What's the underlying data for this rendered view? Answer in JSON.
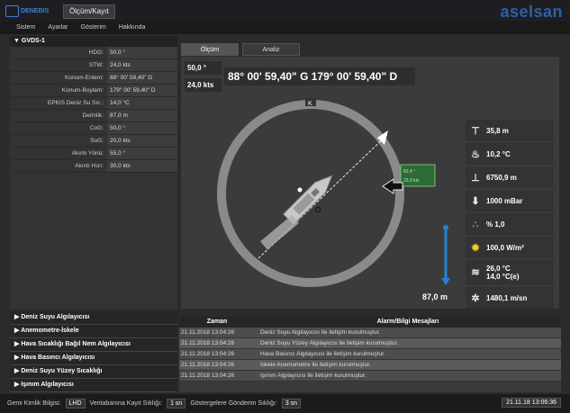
{
  "window": {
    "logo_text": "DENEBIS",
    "tab": "Ölçüm/Kayıt",
    "brand": "aselsan"
  },
  "menu": [
    "Sistem",
    "Ayarlar",
    "Gösterim",
    "Hakkında"
  ],
  "left_panel": {
    "header": "▼ GVDS-1",
    "rows": [
      {
        "label": "HDG:",
        "value": "50,0 °"
      },
      {
        "label": "STW:",
        "value": "24,0 kts"
      },
      {
        "label": "Konum-Enlem:",
        "value": "88° 00' 59,40\" G"
      },
      {
        "label": "Konum-Boylam:",
        "value": "179° 00' 59,40\" D"
      },
      {
        "label": "EPKIS Deniz Su Sıc.:",
        "value": "14,0 °C"
      },
      {
        "label": "Derinlik:",
        "value": "87,0 m"
      },
      {
        "label": "CoG:",
        "value": "50,0 °"
      },
      {
        "label": "SoG:",
        "value": "20,0 kts"
      },
      {
        "label": "Akıntı Yönü:",
        "value": "55,0 °"
      },
      {
        "label": "Akıntı Hızı:",
        "value": "30,0 kts"
      }
    ]
  },
  "accordion": [
    "▶ Deniz Suyu Algılayıcısı",
    "▶ Anemometre-İskele",
    "▶ Hava Sıcaklığı Bağıl Nem Algılayıcısı",
    "▶ Hava Basıncı Algılayıcısı",
    "▶ Deniz Suyu Yüzey Sıcaklığı",
    "▶ Işınım Algılayıcısı"
  ],
  "tabs": [
    "Ölçüm",
    "Analiz"
  ],
  "main": {
    "hdg": "50,0 °",
    "stw": "24,0 kts",
    "position": "88° 00' 59,40\" G 179° 00' 59,40\" D",
    "compass_mark": "K",
    "wind_tag_top": "82,4 °",
    "wind_tag_bottom": "23,9 kts",
    "depth": "87,0 m"
  },
  "right_panel": [
    {
      "icon": "altitude-icon",
      "glyph": "⊤",
      "value": "35,8 m"
    },
    {
      "icon": "thermometer-icon",
      "glyph": "🌡",
      "value": "10,2 °C"
    },
    {
      "icon": "height-icon",
      "glyph": "⊥",
      "value": "6750,9 m"
    },
    {
      "icon": "pressure-arrow-icon",
      "glyph": "⬇",
      "value": "1000 mBar"
    },
    {
      "icon": "humidity-drops-icon",
      "glyph": "💧",
      "value": "% 1,0"
    },
    {
      "icon": "sun-radiation-icon",
      "glyph": "☀",
      "value": "100,0 W/m²"
    },
    {
      "icon": "sea-temp-icon",
      "glyph": "≋",
      "value": "26,0 °C",
      "value2": "14,0 °C(e)"
    },
    {
      "icon": "wind-speed-icon",
      "glyph": "✲",
      "value": "1480,1 m/sn"
    }
  ],
  "alarm": {
    "col_time": "Zaman",
    "col_msg": "Alarm/Bilgi Mesajları",
    "rows": [
      {
        "time": "21.11.2018 13:04:26",
        "msg": "Deniz Suyu Algılayıcısı ile iletişim kurulmuştur."
      },
      {
        "time": "21.11.2018 13:04:26",
        "msg": "Deniz Suyu Yüzey Algılayıcısı ile iletişim kurulmuştur."
      },
      {
        "time": "21.11.2018 13:04:26",
        "msg": "Hava Basıncı Algılayıcısı ile iletişim kurulmuştur."
      },
      {
        "time": "21.11.2018 13:04:26",
        "msg": "İskele Anemometre ile iletişim kurulmuştur."
      },
      {
        "time": "21.11.2018 13:04:26",
        "msg": "Işınım Algılayıcısı ile iletişim kurulmuştur."
      }
    ]
  },
  "status": {
    "ship_label": "Gemi Kimlik Bilgisi:",
    "ship_value": "LHD",
    "db_label": "Veritabanına Kayıt Sıklığı:",
    "db_value": "1 sn",
    "disp_label": "Göstergelere Gönderim Sıklığı:",
    "disp_value": "3 sn",
    "datetime": "21.11.18 13:06:36"
  },
  "colors": {
    "brand": "#2e5fa8",
    "depth_bar": "#2a7fd6",
    "wind_tag": "#2d6b34"
  }
}
